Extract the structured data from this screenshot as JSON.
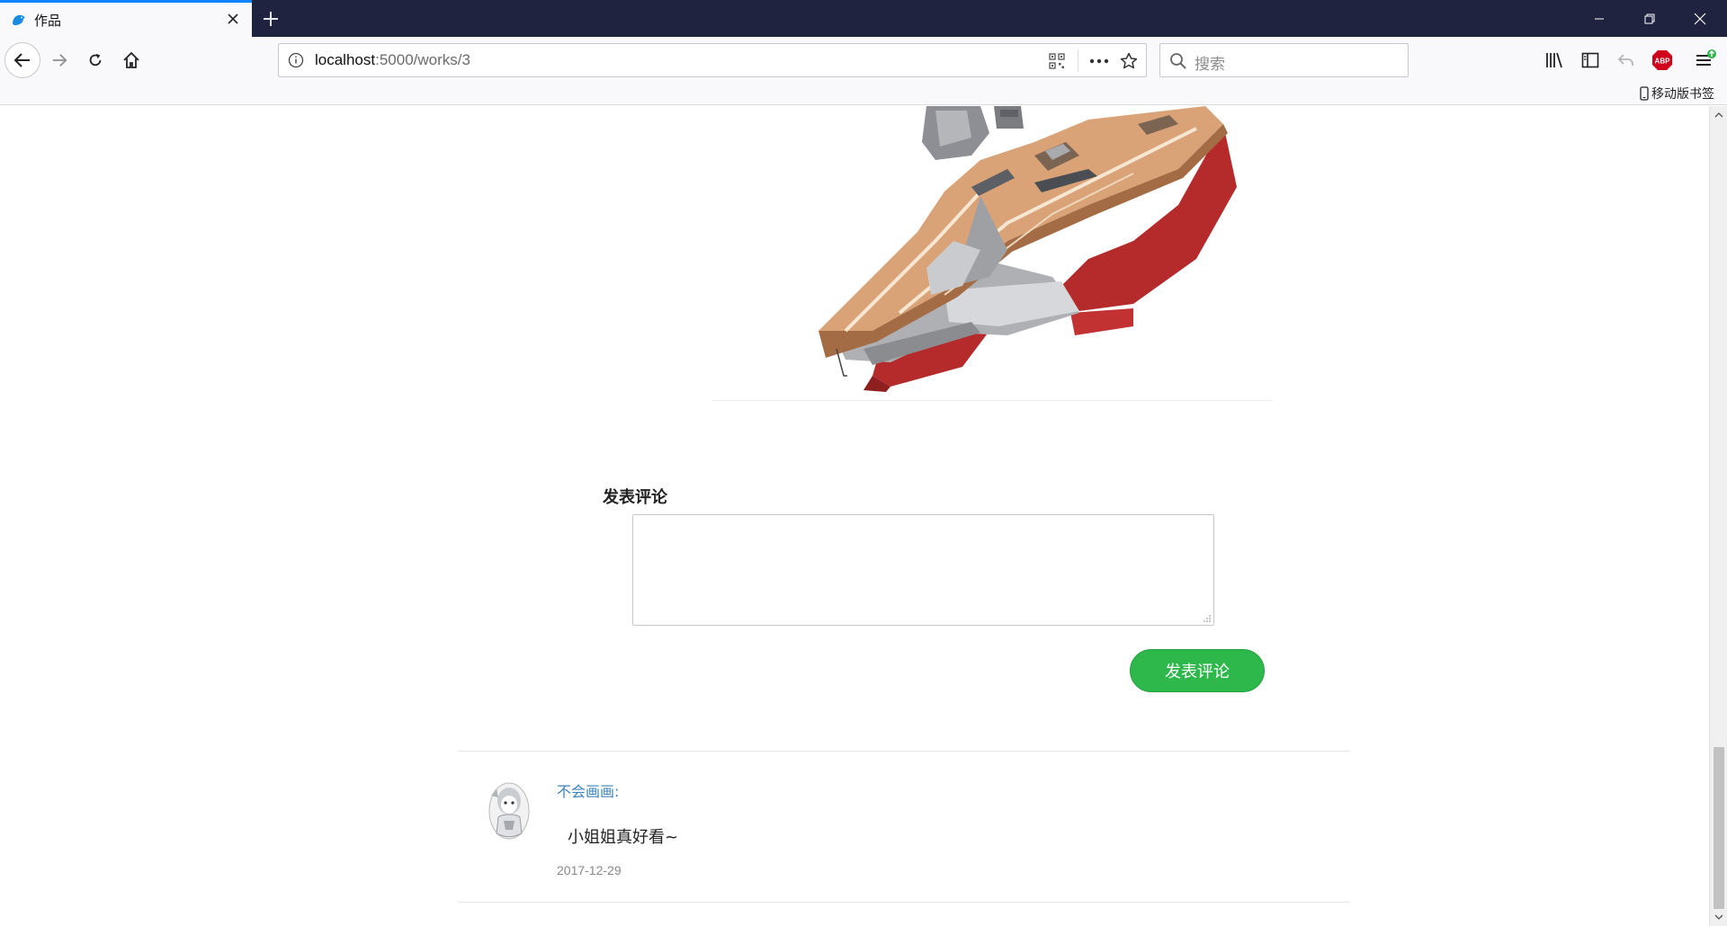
{
  "browser": {
    "tab": {
      "title": "作品"
    },
    "url": {
      "host": "localhost",
      "path": ":5000/works/3"
    },
    "search": {
      "placeholder": "搜索"
    },
    "bookmarks": {
      "mobile_label": "移动版书签"
    },
    "adblock_label": "ABP"
  },
  "page": {
    "comment_form": {
      "heading": "发表评论",
      "textarea_value": "",
      "submit_label": "发表评论"
    },
    "comments": [
      {
        "author": "不会画画:",
        "text": "小姐姐真好看~",
        "date": "2017-12-29"
      }
    ]
  },
  "colors": {
    "tabstrip_bg": "#20233f",
    "accent": "#0a84ff",
    "submit_green": "#2eb84b",
    "author_link": "#3a83b8",
    "adblock_red": "#d0021b"
  },
  "icons": {
    "tab_favicon": "blue-bird-icon",
    "navigation": [
      "back-arrow-icon",
      "forward-arrow-icon",
      "reload-icon",
      "home-icon"
    ],
    "url_bar": [
      "info-icon",
      "qr-code-icon",
      "more-actions-icon",
      "bookmark-star-icon"
    ],
    "toolbar": [
      "library-icon",
      "sidebar-icon",
      "undo-icon",
      "adblock-icon",
      "menu-icon"
    ]
  }
}
